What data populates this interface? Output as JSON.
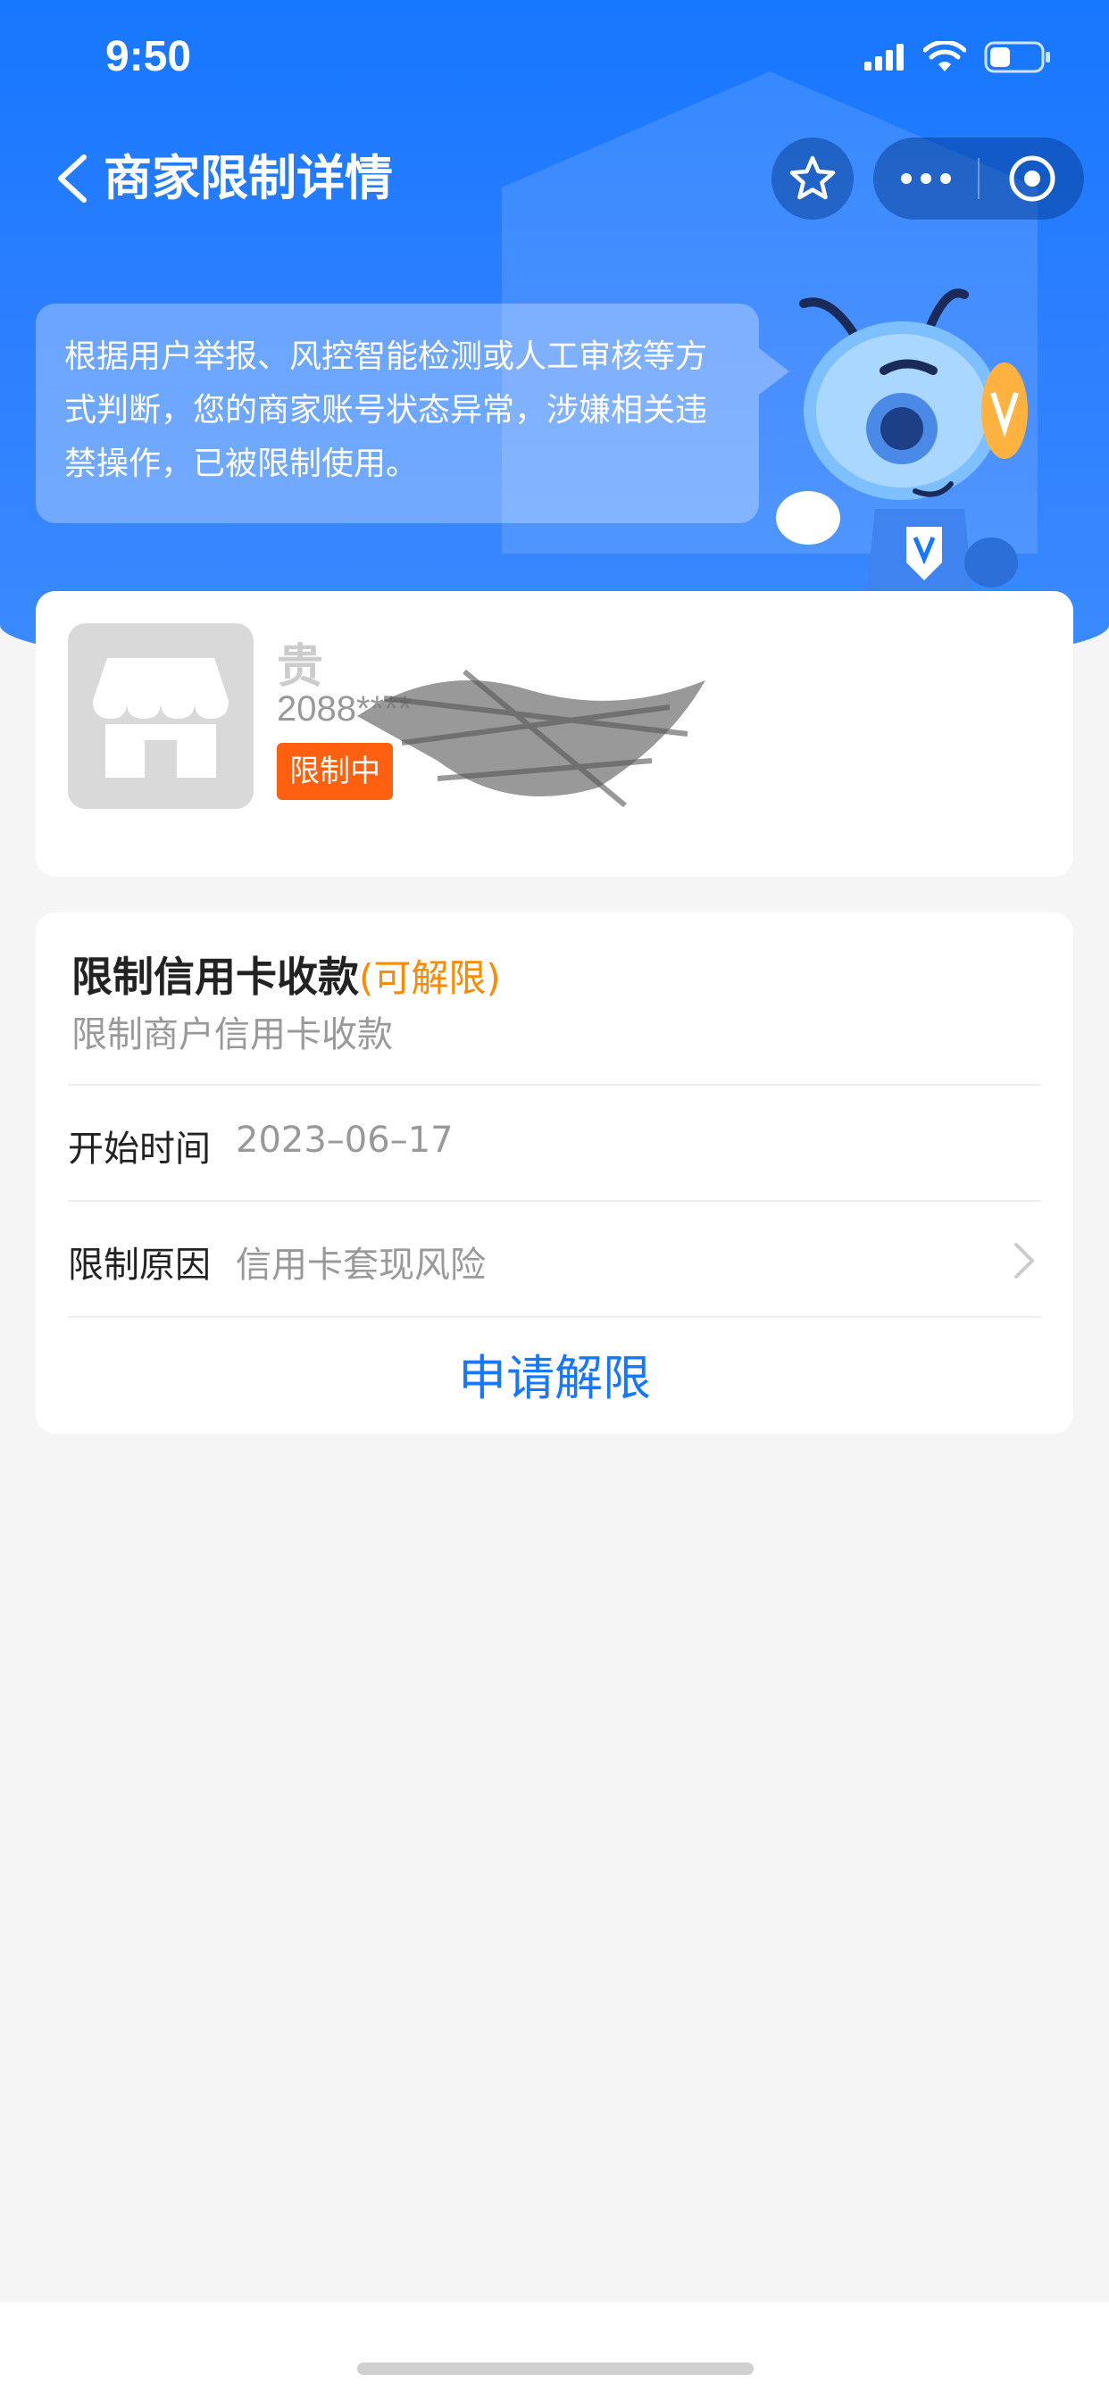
{
  "status_bar": {
    "time": "9:50"
  },
  "nav": {
    "title": "商家限制详情"
  },
  "notice": {
    "text": "根据用户举报、风控智能检测或人工审核等方式判断，您的商家账号状态异常，涉嫌相关违禁操作，已被限制使用。"
  },
  "merchant": {
    "name": "贵",
    "id": "2088****",
    "status_badge": "限制中"
  },
  "restriction": {
    "title": "限制信用卡收款",
    "unlock_tag": "(可解限)",
    "subtitle": "限制商户信用卡收款",
    "start_label": "开始时间",
    "start_value": "2023–06–17",
    "reason_label": "限制原因",
    "reason_value": "信用卡套现风险",
    "apply_button": "申请解限"
  },
  "colors": {
    "brand_blue": "#1677ff",
    "badge_orange": "#ff6010",
    "unlock_orange": "#ff8a00"
  },
  "icons": [
    "back-chevron-icon",
    "star-icon",
    "more-icon",
    "target-icon",
    "store-icon",
    "chevron-right-icon",
    "signal-icon",
    "wifi-icon",
    "battery-icon"
  ]
}
